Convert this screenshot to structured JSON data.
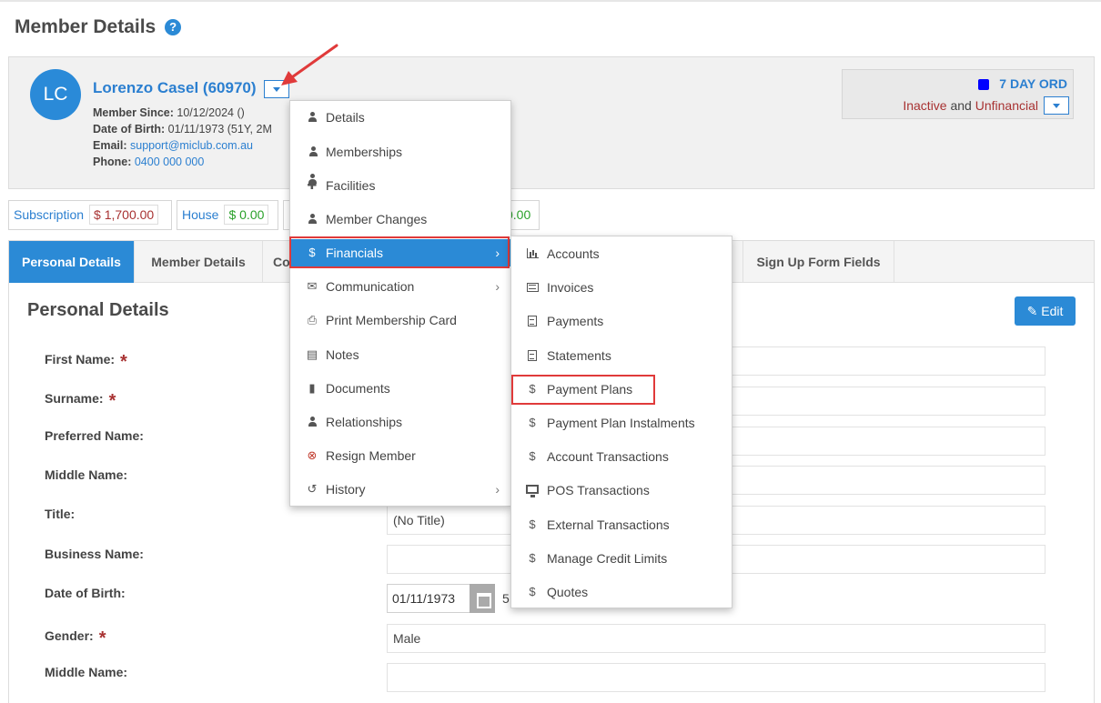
{
  "page": {
    "title": "Member Details",
    "help_icon": "question-circle-icon"
  },
  "member": {
    "initials": "LC",
    "name": "Lorenzo Casel (60970)",
    "since_label": "Member Since:",
    "since_value": "10/12/2024 ()",
    "dob_label": "Date of Birth:",
    "dob_value": "01/11/1973 (51Y, 2M",
    "email_label": "Email:",
    "email_value": "support@miclub.com.au",
    "phone_label": "Phone:",
    "phone_value": "0400 000 000"
  },
  "status": {
    "type": "7 DAY ORD",
    "type_color": "#0000ff",
    "state1": "Inactive",
    "and": "and",
    "state2": "Unfinancial"
  },
  "balances": [
    {
      "label": "Subscription",
      "value": "$ 1,700.00"
    },
    {
      "label": "House",
      "value": "$ 0.00"
    },
    {
      "value": "0.00"
    }
  ],
  "tabs": [
    {
      "label": "Personal Details"
    },
    {
      "label": "Member Details"
    },
    {
      "label": "Co"
    },
    {
      "label": "Sign Up Form Fields"
    }
  ],
  "section": {
    "title": "Personal Details",
    "edit_label": "Edit"
  },
  "fields": [
    {
      "label": "First Name:",
      "required": "*",
      "value": ""
    },
    {
      "label": "Surname:",
      "required": "*",
      "value": ""
    },
    {
      "label": "Preferred Name:",
      "value": ""
    },
    {
      "label": "Middle Name:",
      "value": ""
    },
    {
      "label": "Title:",
      "value": "(No Title)"
    },
    {
      "label": "Business Name:",
      "value": ""
    },
    {
      "label": "Date of Birth:",
      "value": "01/11/1973",
      "extra": "5"
    },
    {
      "label": "Gender:",
      "required": "*",
      "value": "Male"
    },
    {
      "label": "Middle Name:",
      "value": ""
    }
  ],
  "menu": [
    {
      "label": "Details",
      "icon": "user-icon"
    },
    {
      "label": "Memberships",
      "icon": "users-icon"
    },
    {
      "label": "Facilities",
      "icon": "puzzle-icon"
    },
    {
      "label": "Member Changes",
      "icon": "user-icon"
    },
    {
      "label": "Financials",
      "icon": "dollar-icon",
      "chevron": "›"
    },
    {
      "label": "Communication",
      "icon": "envelope-icon",
      "chevron": "›"
    },
    {
      "label": "Print Membership Card",
      "icon": "print-icon"
    },
    {
      "label": "Notes",
      "icon": "archive-icon"
    },
    {
      "label": "Documents",
      "icon": "file-icon"
    },
    {
      "label": "Relationships",
      "icon": "user-icon"
    },
    {
      "label": "Resign Member",
      "icon": "times-circle-icon"
    },
    {
      "label": "History",
      "icon": "history-icon",
      "chevron": "›"
    }
  ],
  "submenu": [
    {
      "label": "Accounts",
      "icon": "bar-chart-icon"
    },
    {
      "label": "Invoices",
      "icon": "list-alt-icon"
    },
    {
      "label": "Payments",
      "icon": "file-text-icon"
    },
    {
      "label": "Statements",
      "icon": "file-text-icon"
    },
    {
      "label": "Payment Plans",
      "icon": "dollar-icon"
    },
    {
      "label": "Payment Plan Instalments",
      "icon": "dollar-icon"
    },
    {
      "label": "Account Transactions",
      "icon": "dollar-icon"
    },
    {
      "label": "POS Transactions",
      "icon": "desktop-icon"
    },
    {
      "label": "External Transactions",
      "icon": "dollar-icon"
    },
    {
      "label": "Manage Credit Limits",
      "icon": "dollar-icon"
    },
    {
      "label": "Quotes",
      "icon": "dollar-icon"
    }
  ],
  "colors": {
    "accent": "#2b8ad6",
    "highlight": "#e03a3a",
    "danger": "#a83232",
    "success": "#2aa12a"
  }
}
